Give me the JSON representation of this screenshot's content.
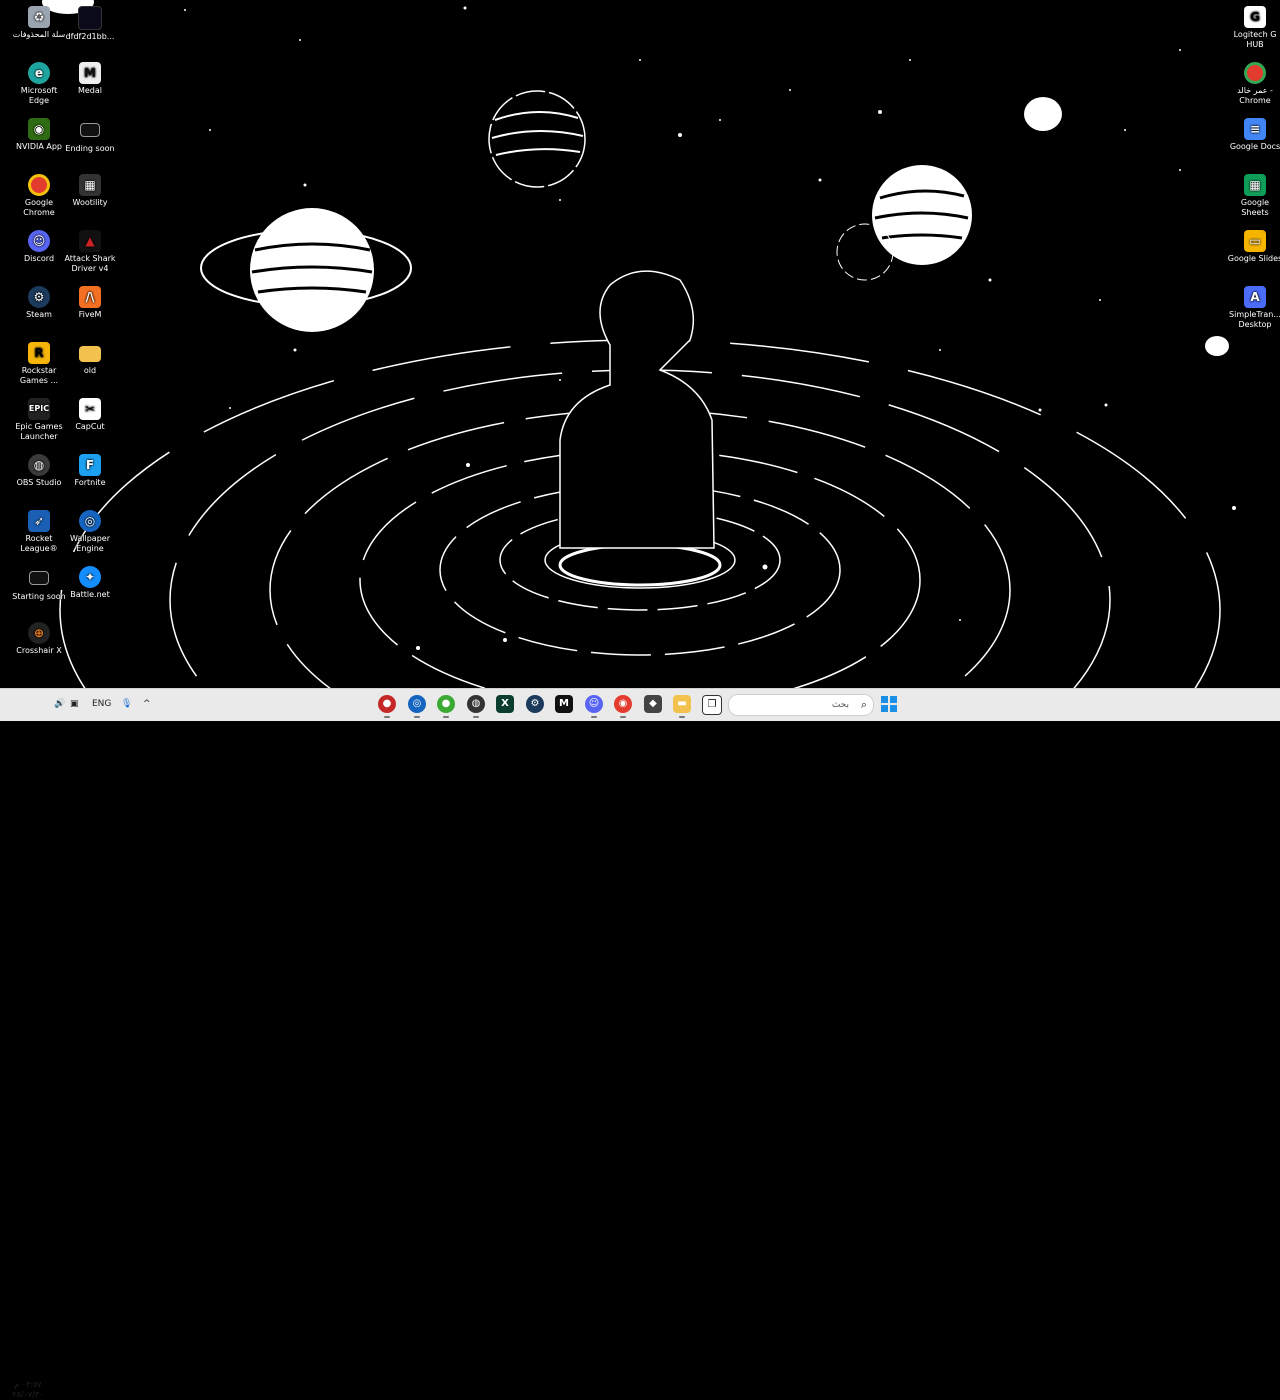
{
  "desktop": {
    "left_col1": [
      {
        "label": "سلة المحذوفات",
        "icon": "recycle-bin-icon"
      },
      {
        "label": "Microsoft Edge",
        "icon": "edge-icon"
      },
      {
        "label": "NVIDIA App",
        "icon": "nvidia-icon"
      },
      {
        "label": "Google Chrome",
        "icon": "chrome-icon"
      },
      {
        "label": "Discord",
        "icon": "discord-icon"
      },
      {
        "label": "Steam",
        "icon": "steam-icon"
      },
      {
        "label": "Rockstar Games ...",
        "icon": "rockstar-icon"
      },
      {
        "label": "Epic Games Launcher",
        "icon": "epic-games-icon"
      },
      {
        "label": "OBS Studio",
        "icon": "obs-icon"
      },
      {
        "label": "Rocket League®",
        "icon": "rocket-league-icon"
      },
      {
        "label": "Starting soon",
        "icon": "video-file-icon"
      },
      {
        "label": "Crosshair X",
        "icon": "crosshair-icon"
      }
    ],
    "left_col2": [
      {
        "label": "dfdf2d1bb...",
        "icon": "image-file-icon"
      },
      {
        "label": "Medal",
        "icon": "medal-icon"
      },
      {
        "label": "Ending soon",
        "icon": "video-file-icon"
      },
      {
        "label": "Wootility",
        "icon": "wootility-icon"
      },
      {
        "label": "Attack Shark Driver v4",
        "icon": "attack-shark-icon"
      },
      {
        "label": "FiveM",
        "icon": "fivem-icon"
      },
      {
        "label": "old",
        "icon": "folder-icon"
      },
      {
        "label": "CapCut",
        "icon": "capcut-icon"
      },
      {
        "label": "Fortnite",
        "icon": "fortnite-icon"
      },
      {
        "label": "Wallpaper Engine",
        "icon": "wallpaper-engine-icon"
      },
      {
        "label": "Battle.net",
        "icon": "battlenet-icon"
      }
    ],
    "right_col": [
      {
        "label": "Logitech G HUB",
        "icon": "logitech-icon"
      },
      {
        "label": "عمر خالد - Chrome",
        "icon": "chrome-profile-icon"
      },
      {
        "label": "Google Docs",
        "icon": "google-docs-icon"
      },
      {
        "label": "Google Sheets",
        "icon": "google-sheets-icon"
      },
      {
        "label": "Google Slides",
        "icon": "google-slides-icon"
      },
      {
        "label": "SimpleTran... Desktop",
        "icon": "simpletrans-icon"
      }
    ]
  },
  "taskbar": {
    "search_placeholder": "بحث",
    "language": "ENG",
    "clock_time": "٠٣:٥٧ م",
    "clock_date": "٢٥/٠٧/٣٠",
    "apps": [
      "app-red-icon",
      "app-globe-icon",
      "app-green-icon",
      "obs-icon",
      "xbox-icon",
      "steam-icon",
      "medal-icon",
      "discord-icon",
      "chrome-icon",
      "app-cube-icon",
      "file-explorer-icon",
      "task-view-icon"
    ]
  },
  "colors": {
    "taskbar_bg": "#eaeaea",
    "windows_blue": "#1b8fe6"
  }
}
